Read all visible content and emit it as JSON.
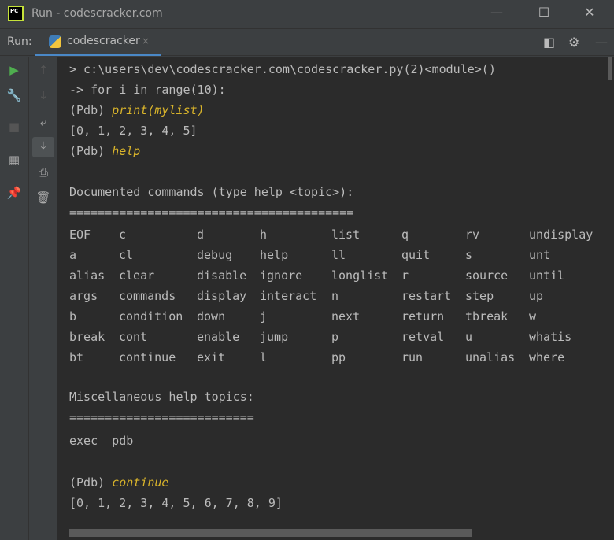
{
  "window": {
    "title": "Run - codescracker.com",
    "logo": "PC",
    "minimize": "—",
    "maximize": "☐",
    "close": "✕"
  },
  "runbar": {
    "label": "Run:",
    "tab": "codescracker",
    "tab_close": "×"
  },
  "console": {
    "lines": [
      "> c:\\users\\dev\\codescracker.com\\codescracker.py(2)<module>()",
      "-> for i in range(10):"
    ],
    "prompt": "(Pdb) ",
    "cmd1": "print(mylist)",
    "out1": "[0, 1, 2, 3, 4, 5]",
    "cmd2": "help",
    "doc_header": "Documented commands (type help <topic>):",
    "doc_rule": "========================================",
    "commands": [
      [
        "EOF",
        "c",
        "d",
        "h",
        "list",
        "q",
        "rv",
        "undisplay"
      ],
      [
        "a",
        "cl",
        "debug",
        "help",
        "ll",
        "quit",
        "s",
        "unt"
      ],
      [
        "alias",
        "clear",
        "disable",
        "ignore",
        "longlist",
        "r",
        "source",
        "until"
      ],
      [
        "args",
        "commands",
        "display",
        "interact",
        "n",
        "restart",
        "step",
        "up"
      ],
      [
        "b",
        "condition",
        "down",
        "j",
        "next",
        "return",
        "tbreak",
        "w"
      ],
      [
        "break",
        "cont",
        "enable",
        "jump",
        "p",
        "retval",
        "u",
        "whatis"
      ],
      [
        "bt",
        "continue",
        "exit",
        "l",
        "pp",
        "run",
        "unalias",
        "where"
      ]
    ],
    "misc_header": "Miscellaneous help topics:",
    "misc_rule": "==========================",
    "misc_topics": "exec  pdb",
    "cmd3": "continue",
    "out2": "[0, 1, 2, 3, 4, 5, 6, 7, 8, 9]"
  }
}
